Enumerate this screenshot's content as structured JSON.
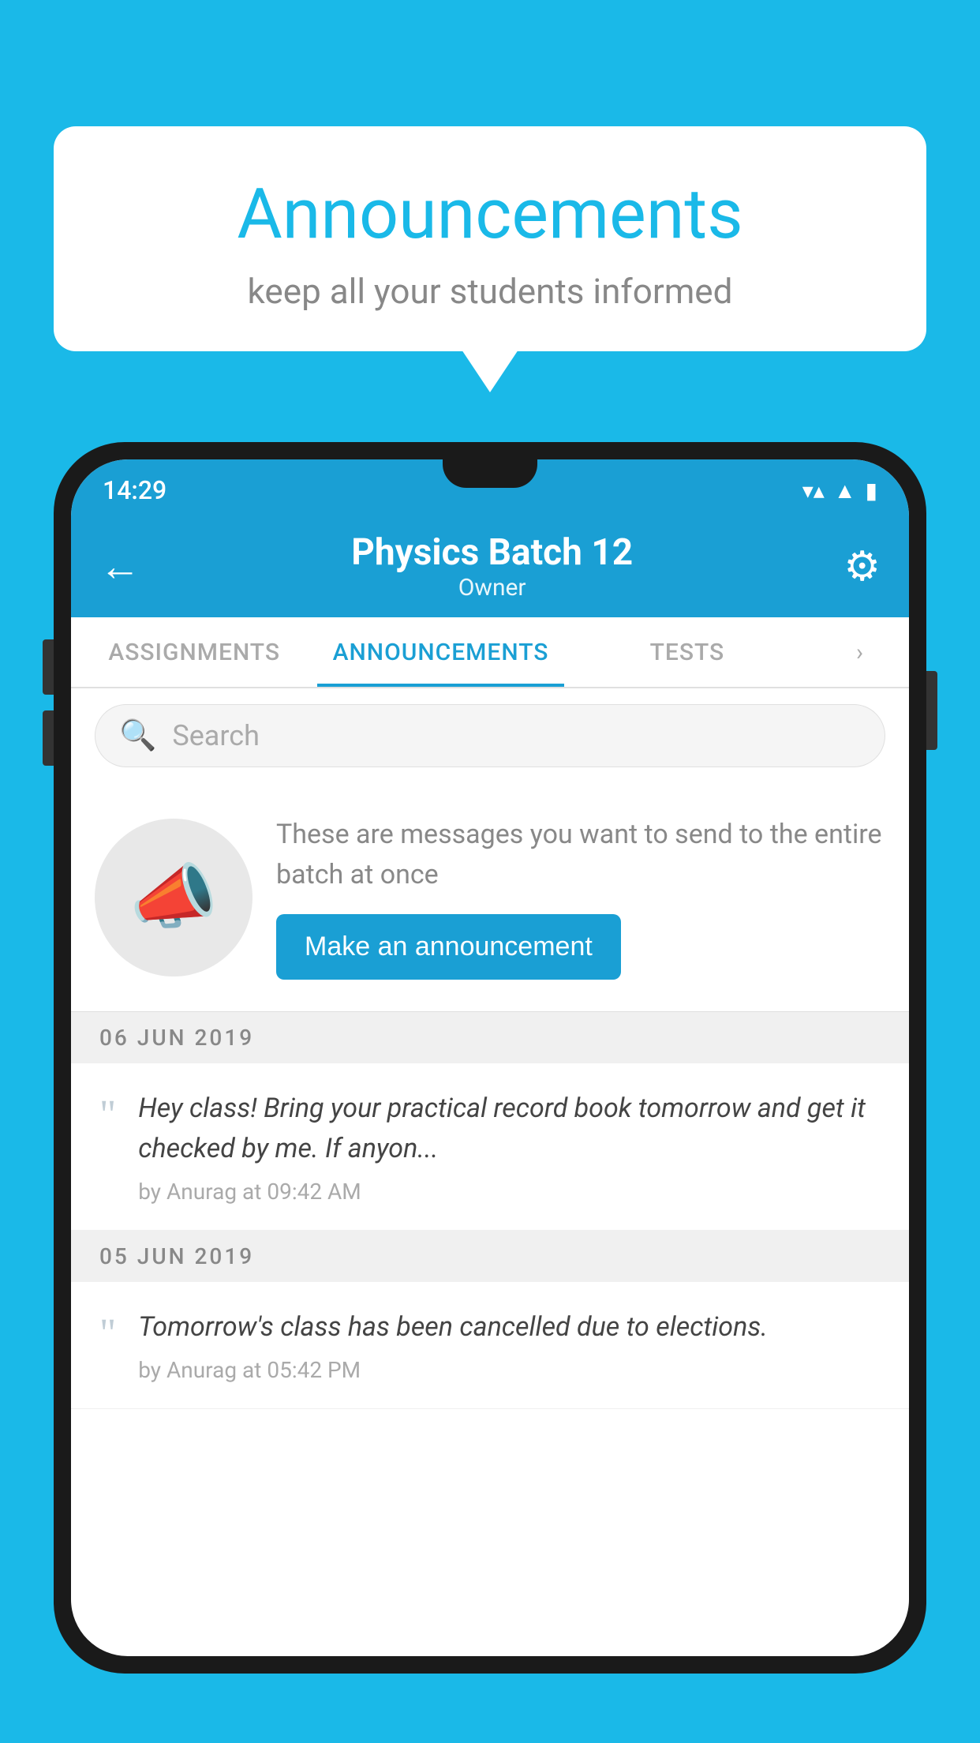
{
  "page": {
    "background_color": "#1ab9e8"
  },
  "speech_bubble": {
    "title": "Announcements",
    "subtitle": "keep all your students informed"
  },
  "status_bar": {
    "time": "14:29",
    "icons": [
      "wifi",
      "signal",
      "battery"
    ]
  },
  "header": {
    "back_label": "←",
    "title": "Physics Batch 12",
    "subtitle": "Owner",
    "gear_label": "⚙"
  },
  "tabs": [
    {
      "label": "ASSIGNMENTS",
      "active": false
    },
    {
      "label": "ANNOUNCEMENTS",
      "active": true
    },
    {
      "label": "TESTS",
      "active": false
    }
  ],
  "search": {
    "placeholder": "Search"
  },
  "promo": {
    "description_text": "These are messages you want to send to the entire batch at once",
    "button_label": "Make an announcement"
  },
  "announcements": [
    {
      "date": "06  JUN  2019",
      "text": "Hey class! Bring your practical record book tomorrow and get it checked by me. If anyon...",
      "meta": "by Anurag at 09:42 AM"
    },
    {
      "date": "05  JUN  2019",
      "text": "Tomorrow's class has been cancelled due to elections.",
      "meta": "by Anurag at 05:42 PM"
    }
  ]
}
